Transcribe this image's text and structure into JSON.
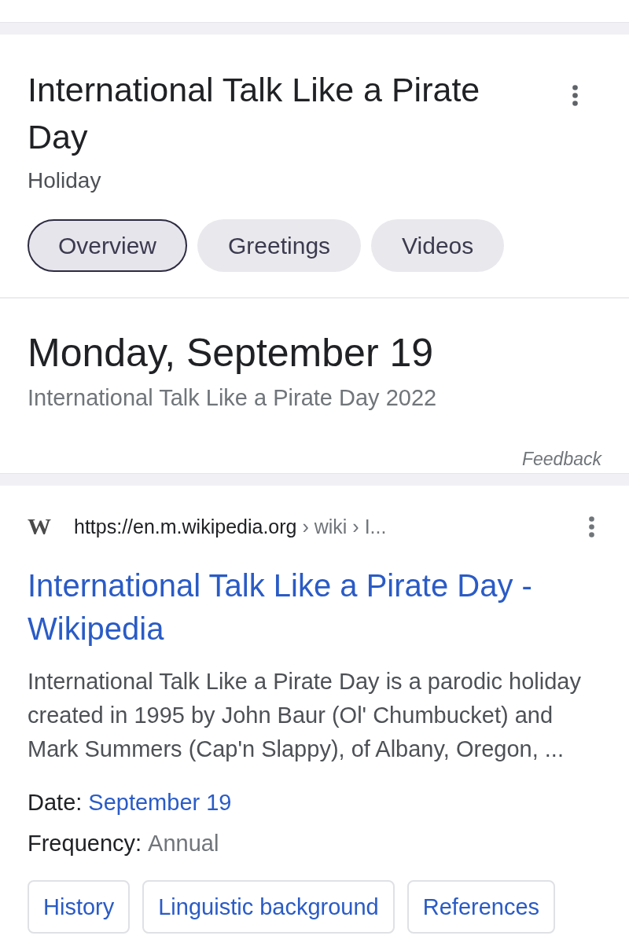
{
  "knowledge_panel": {
    "title": "International Talk Like a Pirate Day",
    "subtitle": "Holiday",
    "tabs": [
      {
        "label": "Overview",
        "selected": true
      },
      {
        "label": "Greetings",
        "selected": false
      },
      {
        "label": "Videos",
        "selected": false
      }
    ]
  },
  "date_card": {
    "date": "Monday, September 19",
    "caption": "International Talk Like a Pirate Day 2022",
    "feedback": "Feedback"
  },
  "result": {
    "favicon": "W",
    "url": "https://en.m.wikipedia.org",
    "breadcrumb": "› wiki › I...",
    "title": "International Talk Like a Pirate Day - Wikipedia",
    "snippet": "International Talk Like a Pirate Day is a parodic holiday created in 1995 by John Baur (Ol' Chumbucket) and Mark Summers (Cap'n Slappy), of Albany, Oregon, ...",
    "facts": [
      {
        "label": "Date:",
        "value": "September 19",
        "kind": "link"
      },
      {
        "label": "Frequency:",
        "value": "Annual",
        "kind": "text"
      }
    ],
    "links": [
      "History",
      "Linguistic background",
      "References"
    ]
  }
}
